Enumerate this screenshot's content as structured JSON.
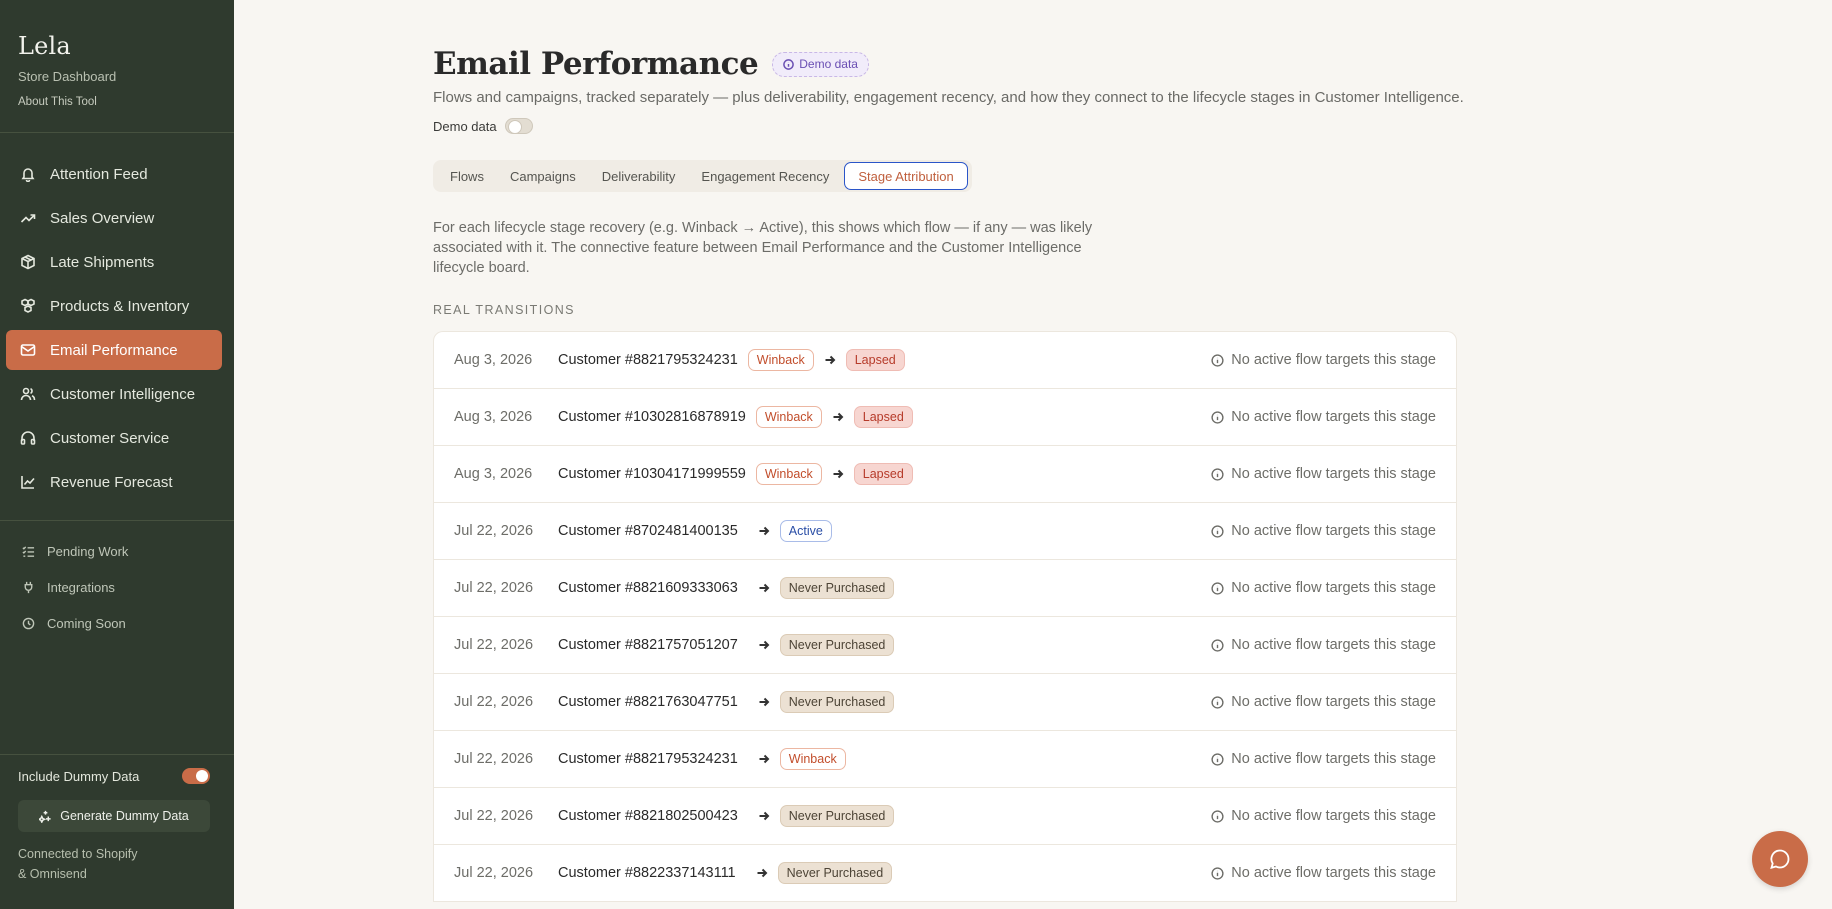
{
  "sidebar": {
    "brand": "Lela",
    "subtitle": "Store Dashboard",
    "about": "About This Tool",
    "nav": [
      {
        "label": "Attention Feed",
        "icon": "bell-icon"
      },
      {
        "label": "Sales Overview",
        "icon": "trending-up-icon"
      },
      {
        "label": "Late Shipments",
        "icon": "package-icon"
      },
      {
        "label": "Products & Inventory",
        "icon": "boxes-icon"
      },
      {
        "label": "Email Performance",
        "icon": "mail-icon"
      },
      {
        "label": "Customer Intelligence",
        "icon": "users-icon"
      },
      {
        "label": "Customer Service",
        "icon": "headphones-icon"
      },
      {
        "label": "Revenue Forecast",
        "icon": "chart-line-icon"
      }
    ],
    "active_nav": "Email Performance",
    "secondary": [
      {
        "label": "Pending Work",
        "icon": "list-check-icon"
      },
      {
        "label": "Integrations",
        "icon": "plug-icon"
      },
      {
        "label": "Coming Soon",
        "icon": "clock-icon"
      }
    ],
    "include_dummy_label": "Include Dummy Data",
    "include_dummy_on": true,
    "generate_label": "Generate Dummy Data",
    "connected_line1": "Connected to Shopify",
    "connected_line2": "& Omnisend"
  },
  "header": {
    "title": "Email Performance",
    "demo_badge": "Demo data",
    "subtitle": "Flows and campaigns, tracked separately — plus deliverability, engagement recency, and how they connect to the lifecycle stages in Customer Intelligence.",
    "demo_toggle_label": "Demo data",
    "demo_toggle_on": false
  },
  "tabs": [
    {
      "label": "Flows"
    },
    {
      "label": "Campaigns"
    },
    {
      "label": "Deliverability"
    },
    {
      "label": "Engagement Recency"
    },
    {
      "label": "Stage Attribution"
    }
  ],
  "active_tab": "Stage Attribution",
  "description": "For each lifecycle stage recovery (e.g. Winback → Active), this shows which flow — if any — was likely associated with it. The connective feature between Email Performance and the Customer Intelligence lifecycle board.",
  "section_label": "REAL TRANSITIONS",
  "no_flow_text": "No active flow targets this stage",
  "transitions": [
    {
      "date": "Aug 3, 2026",
      "customer": "Customer #8821795324231",
      "from": "Winback",
      "to": "Lapsed"
    },
    {
      "date": "Aug 3, 2026",
      "customer": "Customer #10302816878919",
      "from": "Winback",
      "to": "Lapsed"
    },
    {
      "date": "Aug 3, 2026",
      "customer": "Customer #10304171999559",
      "from": "Winback",
      "to": "Lapsed"
    },
    {
      "date": "Jul 22, 2026",
      "customer": "Customer #8702481400135",
      "from": null,
      "to": "Active"
    },
    {
      "date": "Jul 22, 2026",
      "customer": "Customer #8821609333063",
      "from": null,
      "to": "Never Purchased"
    },
    {
      "date": "Jul 22, 2026",
      "customer": "Customer #8821757051207",
      "from": null,
      "to": "Never Purchased"
    },
    {
      "date": "Jul 22, 2026",
      "customer": "Customer #8821763047751",
      "from": null,
      "to": "Never Purchased"
    },
    {
      "date": "Jul 22, 2026",
      "customer": "Customer #8821795324231",
      "from": null,
      "to": "Winback"
    },
    {
      "date": "Jul 22, 2026",
      "customer": "Customer #8821802500423",
      "from": null,
      "to": "Never Purchased"
    },
    {
      "date": "Jul 22, 2026",
      "customer": "Customer #8822337143111",
      "from": null,
      "to": "Never Purchased"
    }
  ],
  "colors": {
    "sidebar_bg": "#2f3a2e",
    "accent": "#c96c48",
    "tab_focus": "#2a55c9"
  },
  "chat_button_icon": "chat-bubble-icon"
}
